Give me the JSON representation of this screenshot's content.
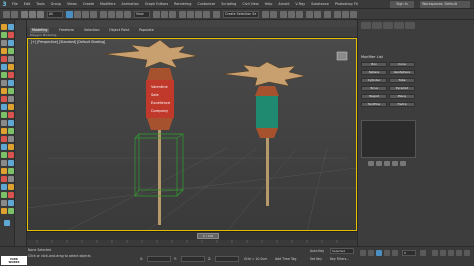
{
  "menubar": {
    "items": [
      "File",
      "Edit",
      "Tools",
      "Group",
      "Views",
      "Create",
      "Modifiers",
      "Animation",
      "Graph Editors",
      "Rendering",
      "Customize",
      "Scripting",
      "Civil View",
      "Help",
      "Arnold",
      "V-Ray",
      "Substance",
      "Photoshop FX"
    ],
    "sign_in": "Sign In",
    "workspace": "Workspaces: Default"
  },
  "toolbar": {
    "filter": "All",
    "view": "View",
    "create_selection_set": "Create Selection Se"
  },
  "ribbon": {
    "tabs": [
      "Modeling",
      "Freeform",
      "Selection",
      "Object Paint",
      "Populate"
    ],
    "active_tab": "Modeling",
    "subtitle": "Polygon Modeling"
  },
  "viewport": {
    "label": "[+] [Perspective] [Standard] [Default Shading]",
    "poster_red_lines": [
      "Valentine",
      "Sale",
      "Excellence",
      "Company"
    ],
    "colors": {
      "cap": "#c8a070",
      "red_band": "#c0392b",
      "teal_band": "#1f8a70",
      "pole": "#b79a6a",
      "selection_box": "#2ea12e",
      "border": "#e0c000"
    }
  },
  "rightpanel": {
    "title": "Modifier List",
    "buttons": [
      "Box",
      "Cone",
      "Sphere",
      "GeoSphere",
      "Cylinder",
      "Tube",
      "Torus",
      "Pyramid",
      "Teapot",
      "Plane",
      "TextPlus",
      "Hedra"
    ]
  },
  "timeline": {
    "slider": "0 / 100",
    "ticks": [
      "0",
      "5",
      "10",
      "15",
      "20",
      "25",
      "30",
      "35",
      "40",
      "45",
      "50",
      "55",
      "60",
      "65",
      "70",
      "75",
      "80",
      "85",
      "90",
      "95",
      "100"
    ]
  },
  "statusbar": {
    "line1": "None Selected",
    "line2": "Click or click-and-drag to select objects",
    "x_label": "X:",
    "y_label": "Y:",
    "z_label": "Z:",
    "grid": "Grid = 10.0cm",
    "add_time_tag": "Add Time Tag",
    "auto_key": "Auto Key",
    "selected": "Selected",
    "set_key": "Set Key",
    "key_filters": "Key Filters...",
    "frame": "0",
    "logo_line1": "PARK",
    "logo_line2": "WORKS"
  }
}
